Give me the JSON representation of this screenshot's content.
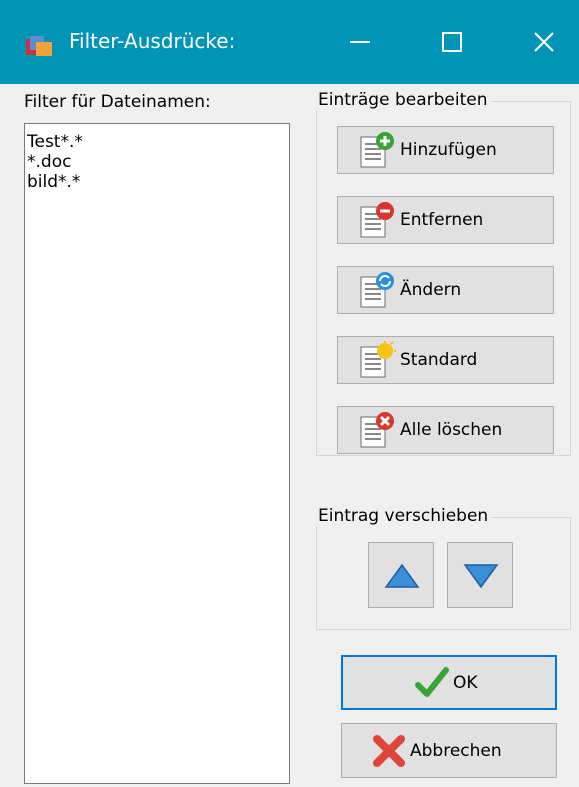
{
  "window": {
    "title": "Filter-Ausdrücke:",
    "icon": "folder-filter-icon"
  },
  "titlebar_buttons": {
    "minimize_icon": "minimize-icon",
    "maximize_icon": "maximize-icon",
    "close_icon": "close-icon"
  },
  "list": {
    "label": "Filter für Dateinamen:",
    "items": [
      "Test*.*",
      "*.doc",
      "bild*.*"
    ]
  },
  "edit_group": {
    "label": "Einträge bearbeiten",
    "buttons": [
      {
        "label": "Hinzufügen",
        "icon": "document-add-icon"
      },
      {
        "label": "Entfernen",
        "icon": "document-remove-icon"
      },
      {
        "label": "Ändern",
        "icon": "document-refresh-icon"
      },
      {
        "label": "Standard",
        "icon": "document-default-icon"
      },
      {
        "label": "Alle löschen",
        "icon": "document-clear-icon"
      }
    ]
  },
  "move_group": {
    "label": "Eintrag verschieben",
    "up_icon": "arrow-up-icon",
    "down_icon": "arrow-down-icon"
  },
  "dialog": {
    "ok_label": "OK",
    "cancel_label": "Abbrechen"
  },
  "colors": {
    "titlebar": "#0095b6",
    "focus_border": "#0078d7",
    "add": "#3aa335",
    "remove": "#d9352b",
    "refresh": "#2a8fe0",
    "default": "#f7c318",
    "arrow": "#3b8fd6"
  }
}
